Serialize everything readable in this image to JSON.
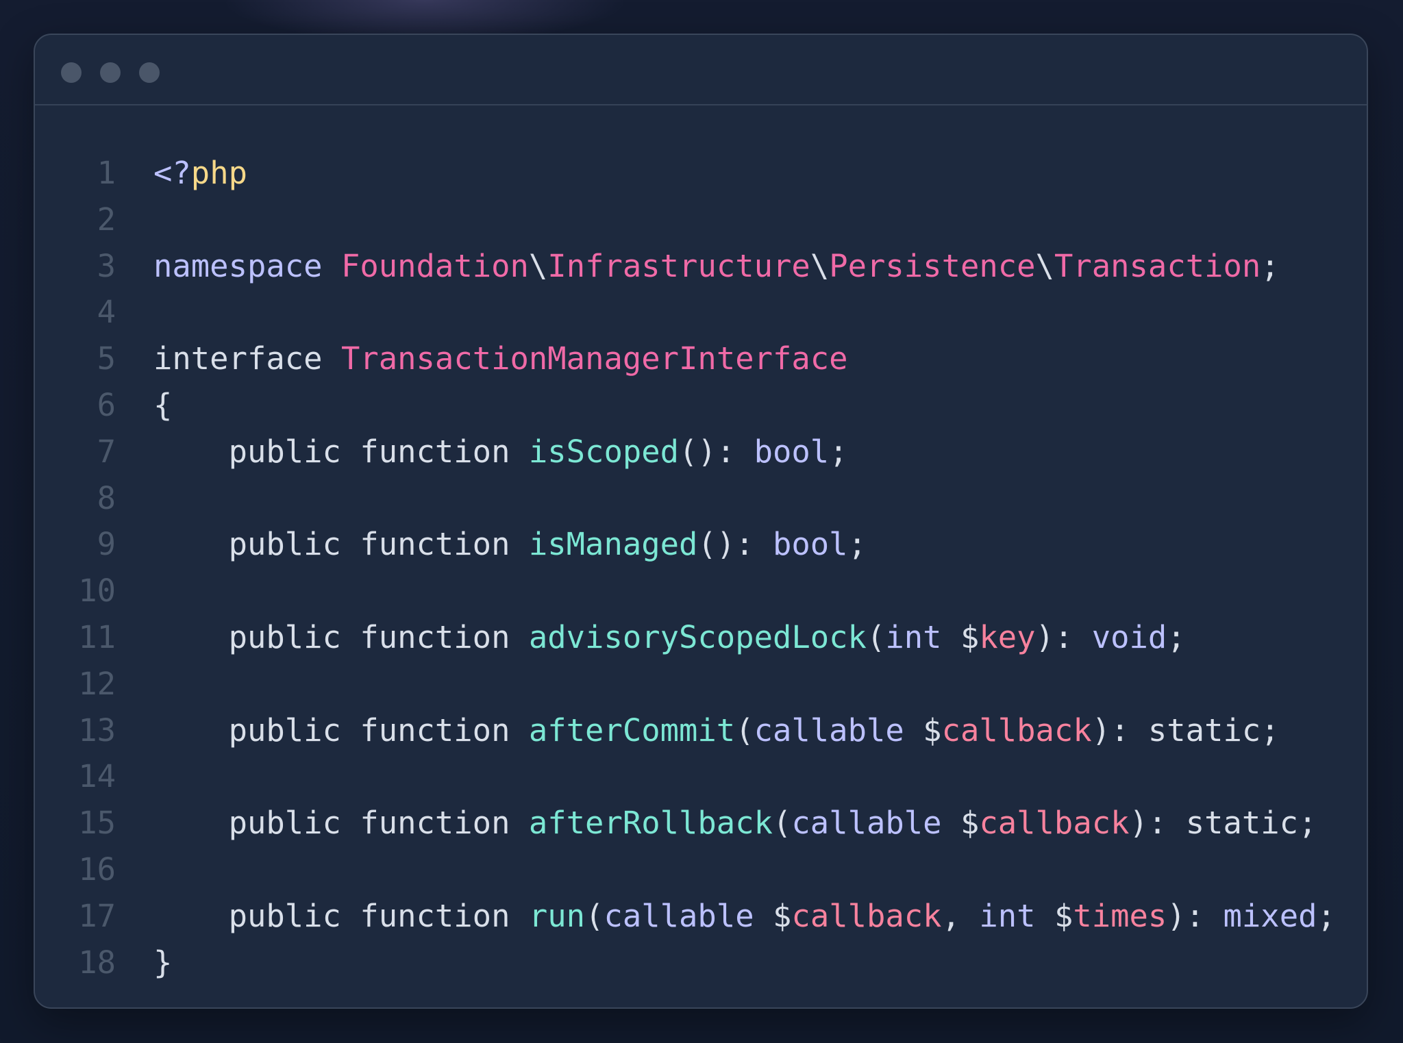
{
  "window": {
    "controls": [
      "window-dot",
      "window-dot",
      "window-dot"
    ]
  },
  "code": {
    "language": "php",
    "lines": [
      {
        "n": "1",
        "tokens": [
          {
            "t": "<?",
            "k": "tag"
          },
          {
            "t": "php",
            "k": "php"
          }
        ]
      },
      {
        "n": "2",
        "tokens": []
      },
      {
        "n": "3",
        "tokens": [
          {
            "t": "namespace",
            "k": "kw"
          },
          {
            "t": " ",
            "k": "plain"
          },
          {
            "t": "Foundation",
            "k": "ns"
          },
          {
            "t": "\\",
            "k": "plain"
          },
          {
            "t": "Infrastructure",
            "k": "ns"
          },
          {
            "t": "\\",
            "k": "plain"
          },
          {
            "t": "Persistence",
            "k": "ns"
          },
          {
            "t": "\\",
            "k": "plain"
          },
          {
            "t": "Transaction",
            "k": "ns"
          },
          {
            "t": ";",
            "k": "punc"
          }
        ]
      },
      {
        "n": "4",
        "tokens": []
      },
      {
        "n": "5",
        "tokens": [
          {
            "t": "interface",
            "k": "plain"
          },
          {
            "t": " ",
            "k": "plain"
          },
          {
            "t": "TransactionManagerInterface",
            "k": "cls"
          }
        ]
      },
      {
        "n": "6",
        "tokens": [
          {
            "t": "{",
            "k": "punc"
          }
        ]
      },
      {
        "n": "7",
        "tokens": [
          {
            "t": "    public function ",
            "k": "plain"
          },
          {
            "t": "isScoped",
            "k": "fn"
          },
          {
            "t": "(): ",
            "k": "punc"
          },
          {
            "t": "bool",
            "k": "type"
          },
          {
            "t": ";",
            "k": "punc"
          }
        ]
      },
      {
        "n": "8",
        "tokens": []
      },
      {
        "n": "9",
        "tokens": [
          {
            "t": "    public function ",
            "k": "plain"
          },
          {
            "t": "isManaged",
            "k": "fn"
          },
          {
            "t": "(): ",
            "k": "punc"
          },
          {
            "t": "bool",
            "k": "type"
          },
          {
            "t": ";",
            "k": "punc"
          }
        ]
      },
      {
        "n": "10",
        "tokens": []
      },
      {
        "n": "11",
        "tokens": [
          {
            "t": "    public function ",
            "k": "plain"
          },
          {
            "t": "advisoryScopedLock",
            "k": "fn"
          },
          {
            "t": "(",
            "k": "punc"
          },
          {
            "t": "int",
            "k": "type"
          },
          {
            "t": " $",
            "k": "plain"
          },
          {
            "t": "key",
            "k": "var"
          },
          {
            "t": "): ",
            "k": "punc"
          },
          {
            "t": "void",
            "k": "type"
          },
          {
            "t": ";",
            "k": "punc"
          }
        ]
      },
      {
        "n": "12",
        "tokens": []
      },
      {
        "n": "13",
        "tokens": [
          {
            "t": "    public function ",
            "k": "plain"
          },
          {
            "t": "afterCommit",
            "k": "fn"
          },
          {
            "t": "(",
            "k": "punc"
          },
          {
            "t": "callable",
            "k": "type"
          },
          {
            "t": " $",
            "k": "plain"
          },
          {
            "t": "callback",
            "k": "var"
          },
          {
            "t": "): static;",
            "k": "punc"
          }
        ]
      },
      {
        "n": "14",
        "tokens": []
      },
      {
        "n": "15",
        "tokens": [
          {
            "t": "    public function ",
            "k": "plain"
          },
          {
            "t": "afterRollback",
            "k": "fn"
          },
          {
            "t": "(",
            "k": "punc"
          },
          {
            "t": "callable",
            "k": "type"
          },
          {
            "t": " $",
            "k": "plain"
          },
          {
            "t": "callback",
            "k": "var"
          },
          {
            "t": "): static;",
            "k": "punc"
          }
        ]
      },
      {
        "n": "16",
        "tokens": []
      },
      {
        "n": "17",
        "tokens": [
          {
            "t": "    public function ",
            "k": "plain"
          },
          {
            "t": "run",
            "k": "fn"
          },
          {
            "t": "(",
            "k": "punc"
          },
          {
            "t": "callable",
            "k": "type"
          },
          {
            "t": " $",
            "k": "plain"
          },
          {
            "t": "callback",
            "k": "var"
          },
          {
            "t": ", ",
            "k": "punc"
          },
          {
            "t": "int",
            "k": "type"
          },
          {
            "t": " $",
            "k": "plain"
          },
          {
            "t": "times",
            "k": "var"
          },
          {
            "t": "): ",
            "k": "punc"
          },
          {
            "t": "mixed",
            "k": "type"
          },
          {
            "t": ";",
            "k": "punc"
          }
        ]
      },
      {
        "n": "18",
        "tokens": [
          {
            "t": "}",
            "k": "punc"
          }
        ]
      }
    ]
  },
  "colors": {
    "background": "#121a2c",
    "window": "#1d293e",
    "line_numbers": "#4b586b",
    "keyword": "#bcc1ff",
    "php_tag": "#f6d889",
    "namespace_class": "#f06aa7",
    "function_name": "#7ce7d4",
    "variable": "#f7829e",
    "plain": "#d9dfe9"
  }
}
